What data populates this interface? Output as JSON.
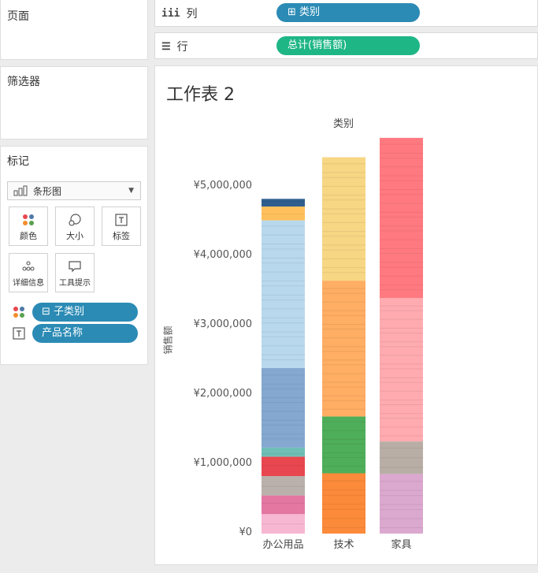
{
  "panels": {
    "pages_title": "页面",
    "filters_title": "筛选器",
    "marks_title": "标记"
  },
  "shelves": {
    "columns": {
      "icon": "iii",
      "label": "列",
      "pill": "⊞ 类别"
    },
    "rows": {
      "icon": "☰",
      "label": "行",
      "pill": "总计(销售额)"
    }
  },
  "marks": {
    "type_label": "条形图",
    "buttons": [
      {
        "label": "颜色",
        "icon": "color-dots-icon"
      },
      {
        "label": "大小",
        "icon": "size-shapes-icon"
      },
      {
        "label": "标签",
        "icon": "text-label-icon"
      },
      {
        "label": "详细信息",
        "icon": "detail-dots-icon"
      },
      {
        "label": "工具提示",
        "icon": "tooltip-bubble-icon"
      }
    ],
    "fields": [
      {
        "label": "⊟ 子类别",
        "icon": "color-dots-icon"
      },
      {
        "label": "产品名称",
        "icon": "text-label-icon"
      }
    ]
  },
  "worksheet": {
    "title": "工作表 2"
  },
  "colors": {
    "pill_blue": "#2b8bb5",
    "pill_green": "#1fb686"
  },
  "chart_data": {
    "type": "bar",
    "stacked": true,
    "title": "类别",
    "ylabel": "销售额",
    "ylim": [
      0,
      5800000
    ],
    "yticks": [
      0,
      1000000,
      2000000,
      3000000,
      4000000,
      5000000
    ],
    "ytick_labels": [
      "¥0",
      "¥1,000,000",
      "¥2,000,000",
      "¥3,000,000",
      "¥4,000,000",
      "¥5,000,000"
    ],
    "categories": [
      "办公用品",
      "技术",
      "家具"
    ],
    "stacks": [
      [
        {
          "value": 280000,
          "color": "#f7b6d2"
        },
        {
          "value": 270000,
          "color": "#e377a2"
        },
        {
          "value": 280000,
          "color": "#bab0ac"
        },
        {
          "value": 280000,
          "color": "#e8474f"
        },
        {
          "value": 130000,
          "color": "#6fbfb7"
        },
        {
          "value": 1150000,
          "color": "#84a8d0"
        },
        {
          "value": 2130000,
          "color": "#b8d8ee"
        },
        {
          "value": 200000,
          "color": "#ffc05c"
        },
        {
          "value": 110000,
          "color": "#2f5f8f"
        }
      ],
      [
        {
          "value": 870000,
          "color": "#fb8a3a"
        },
        {
          "value": 820000,
          "color": "#4fae5a"
        },
        {
          "value": 1960000,
          "color": "#ffae63"
        },
        {
          "value": 1780000,
          "color": "#f7d684"
        }
      ],
      [
        {
          "value": 860000,
          "color": "#dba8cf"
        },
        {
          "value": 470000,
          "color": "#b9aea6"
        },
        {
          "value": 2070000,
          "color": "#ffabb0"
        },
        {
          "value": 2310000,
          "color": "#ff7a80"
        }
      ]
    ]
  }
}
